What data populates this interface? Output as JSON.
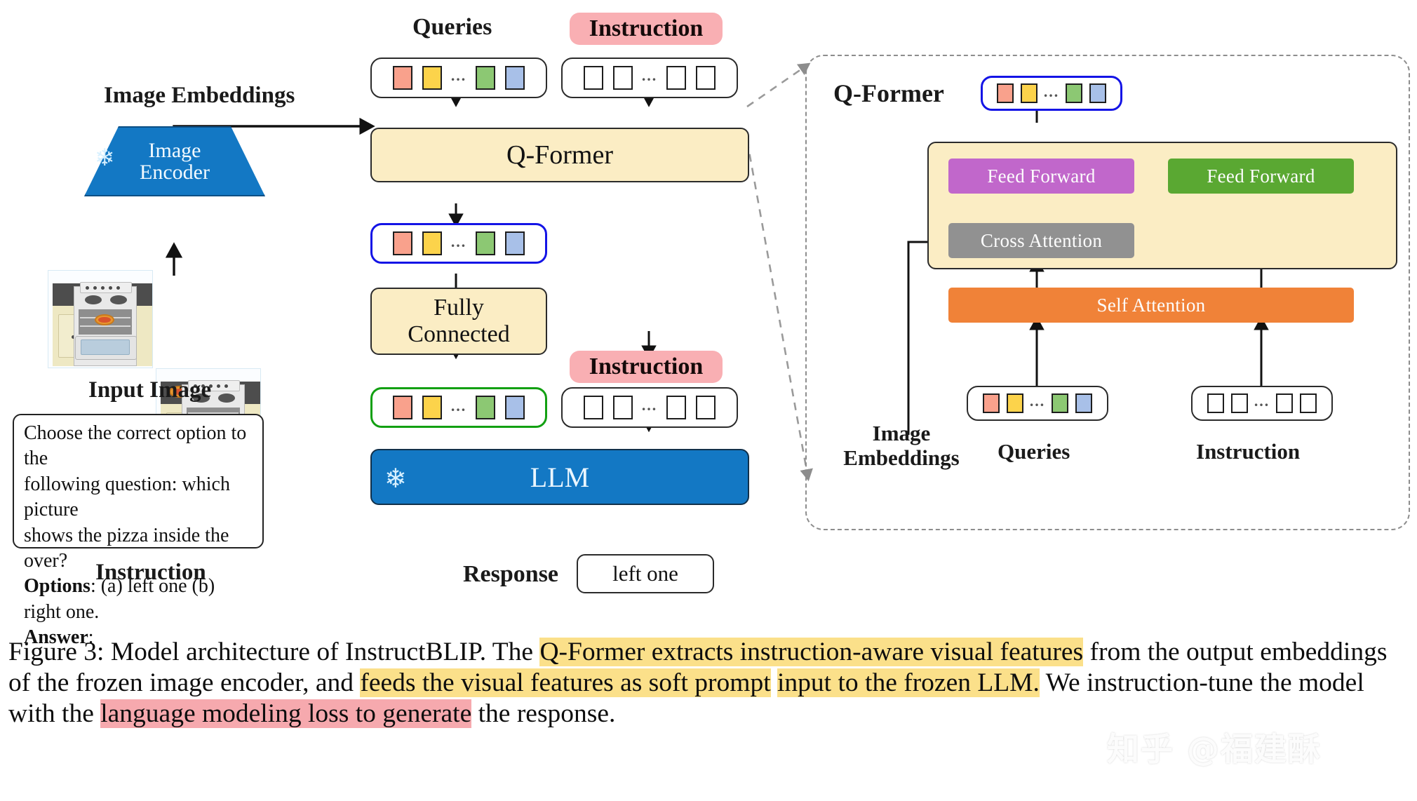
{
  "figure": {
    "left_column": {
      "image_embeddings_label": "Image Embeddings",
      "encoder_line1": "Image",
      "encoder_line2": "Encoder",
      "encoder_frozen_icon": "snowflake-icon",
      "input_image_label": "Input Image",
      "instruction_label": "Instruction",
      "prompt_line1": "Choose the correct option to the",
      "prompt_line2": "following question: which picture",
      "prompt_line3": "shows the pizza inside the over?",
      "prompt_options_key": "Options",
      "prompt_options_value": ": (a) left one (b) right one.",
      "prompt_answer_key": "Answer",
      "prompt_answer_value": ":"
    },
    "middle_column": {
      "queries_label": "Queries",
      "instruction_top_label": "Instruction",
      "qformer_label": "Q-Former",
      "fully_connected_line1": "Fully",
      "fully_connected_line2": "Connected",
      "instruction_mid_label": "Instruction",
      "llm_label": "LLM",
      "llm_frozen_icon": "snowflake-icon",
      "response_label": "Response",
      "response_value": "left one"
    },
    "right_panel": {
      "title": "Q-Former",
      "feed_forward_left": "Feed Forward",
      "feed_forward_right": "Feed Forward",
      "cross_attention": "Cross Attention",
      "self_attention": "Self Attention",
      "image_embeddings_line1": "Image",
      "image_embeddings_line2": "Embeddings",
      "queries_label": "Queries",
      "instruction_label": "Instruction"
    },
    "token_colors": [
      "#f9a18c",
      "#fcd34b",
      "#8cc873",
      "#a8c0e8"
    ],
    "colors": {
      "block_yellow": "#fbedc4",
      "block_blue": "#1378c4",
      "feed_forward_left": "#c167cb",
      "feed_forward_right": "#5aa832",
      "cross_attention": "#919191",
      "self_attention": "#f08238",
      "highlight_yellow": "#fbe08a",
      "highlight_pink": "#f6a9ae",
      "query_border_blue": "#1414e6",
      "query_border_green": "#12a012",
      "dashed_panel": "#8d8d8d"
    }
  },
  "caption": {
    "seg1": "Figure 3: Model architecture of InstructBLIP. The ",
    "hl1": "Q-Former extracts instruction-aware visual features",
    "seg2": "from the output embeddings of the frozen image encoder, and ",
    "hl2": "feeds the visual features as soft prompt",
    "hl3": "input to the frozen LLM.",
    "seg3": " We instruction-tune the model with the ",
    "hl4": "language modeling loss to generate",
    "seg4": "the response."
  },
  "watermark": {
    "text": "知乎 @福建酥"
  }
}
